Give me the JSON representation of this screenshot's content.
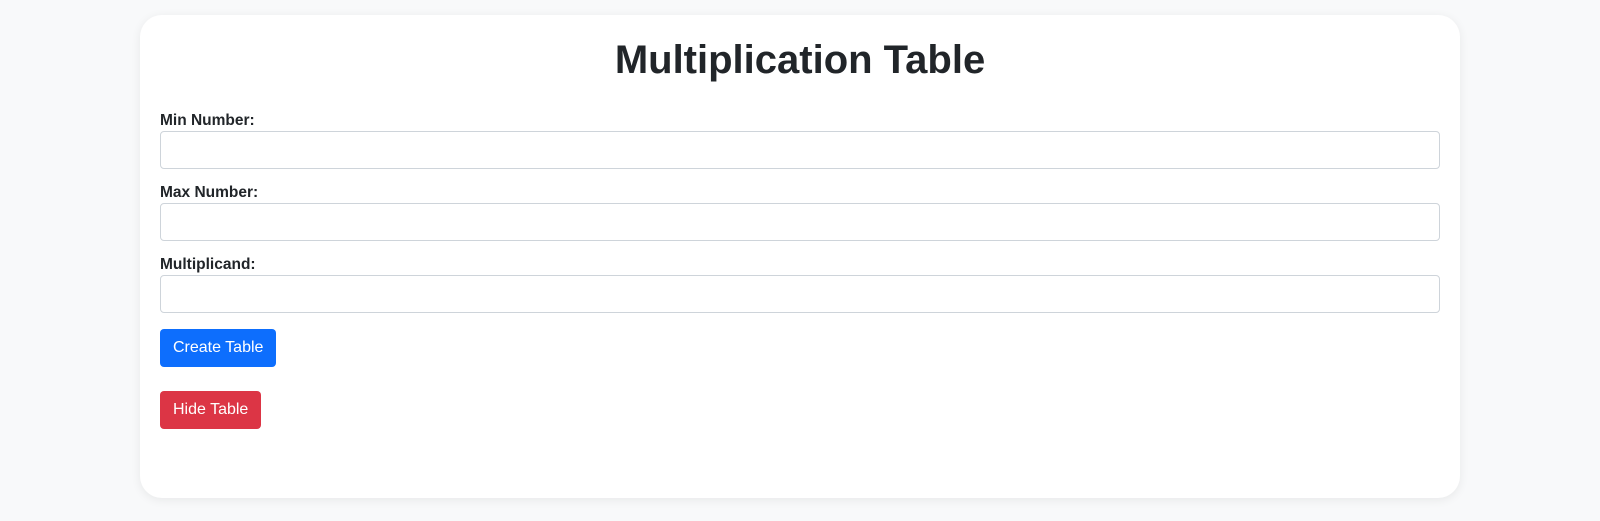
{
  "page": {
    "title": "Multiplication Table"
  },
  "form": {
    "fields": [
      {
        "label": "Min Number:",
        "value": "",
        "placeholder": ""
      },
      {
        "label": "Max Number:",
        "value": "",
        "placeholder": ""
      },
      {
        "label": "Multiplicand:",
        "value": "",
        "placeholder": ""
      }
    ]
  },
  "buttons": {
    "create_label": "Create Table",
    "hide_label": "Hide Table"
  },
  "colors": {
    "background": "#f8f9fa",
    "card": "#ffffff",
    "primary": "#0d6efd",
    "danger": "#dc3545",
    "text": "#212529"
  }
}
